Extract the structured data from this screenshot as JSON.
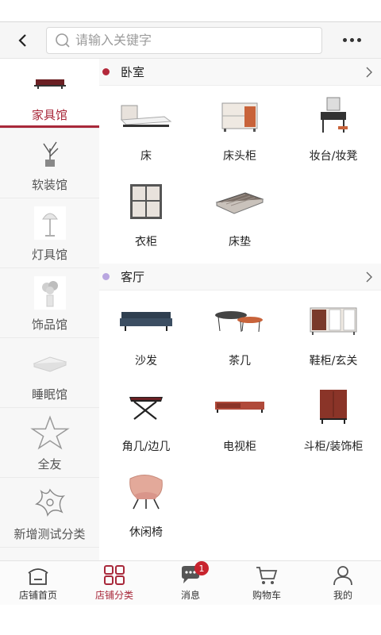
{
  "search": {
    "placeholder": "请输入关键字"
  },
  "colors": {
    "accent": "#a8283a",
    "badge": "#c8232e",
    "bedroom_dot": "#b3283a",
    "living_dot": "#b9a6e0"
  },
  "sidebar": {
    "items": [
      {
        "label": "家具馆",
        "icon": "furniture-icon",
        "active": true
      },
      {
        "label": "软装馆",
        "icon": "soft-decor-icon",
        "active": false
      },
      {
        "label": "灯具馆",
        "icon": "lamp-icon",
        "active": false
      },
      {
        "label": "饰品馆",
        "icon": "ornament-icon",
        "active": false
      },
      {
        "label": "睡眠馆",
        "icon": "sleep-icon",
        "active": false
      },
      {
        "label": "全友",
        "icon": "star-icon",
        "active": false
      },
      {
        "label": "新增测试分类",
        "icon": "test-category-icon",
        "active": false
      }
    ]
  },
  "sections": [
    {
      "title": "卧室",
      "items": [
        {
          "label": "床",
          "icon": "bed-icon"
        },
        {
          "label": "床头柜",
          "icon": "nightstand-icon"
        },
        {
          "label": "妆台/妆凳",
          "icon": "dresser-icon"
        },
        {
          "label": "衣柜",
          "icon": "wardrobe-icon"
        },
        {
          "label": "床垫",
          "icon": "mattress-icon"
        }
      ]
    },
    {
      "title": "客厅",
      "items": [
        {
          "label": "沙发",
          "icon": "sofa-icon"
        },
        {
          "label": "茶几",
          "icon": "coffee-table-icon"
        },
        {
          "label": "鞋柜/玄关",
          "icon": "shoe-cabinet-icon"
        },
        {
          "label": "角几/边几",
          "icon": "side-table-icon"
        },
        {
          "label": "电视柜",
          "icon": "tv-cabinet-icon"
        },
        {
          "label": "斗柜/装饰柜",
          "icon": "chest-icon"
        },
        {
          "label": "休闲椅",
          "icon": "lounge-chair-icon"
        }
      ]
    }
  ],
  "tabbar": {
    "items": [
      {
        "label": "店铺首页",
        "icon": "store-home-icon",
        "active": false
      },
      {
        "label": "店铺分类",
        "icon": "category-grid-icon",
        "active": true
      },
      {
        "label": "消息",
        "icon": "message-icon",
        "active": false,
        "badge": "1"
      },
      {
        "label": "购物车",
        "icon": "cart-icon",
        "active": false
      },
      {
        "label": "我的",
        "icon": "user-icon",
        "active": false
      }
    ]
  }
}
